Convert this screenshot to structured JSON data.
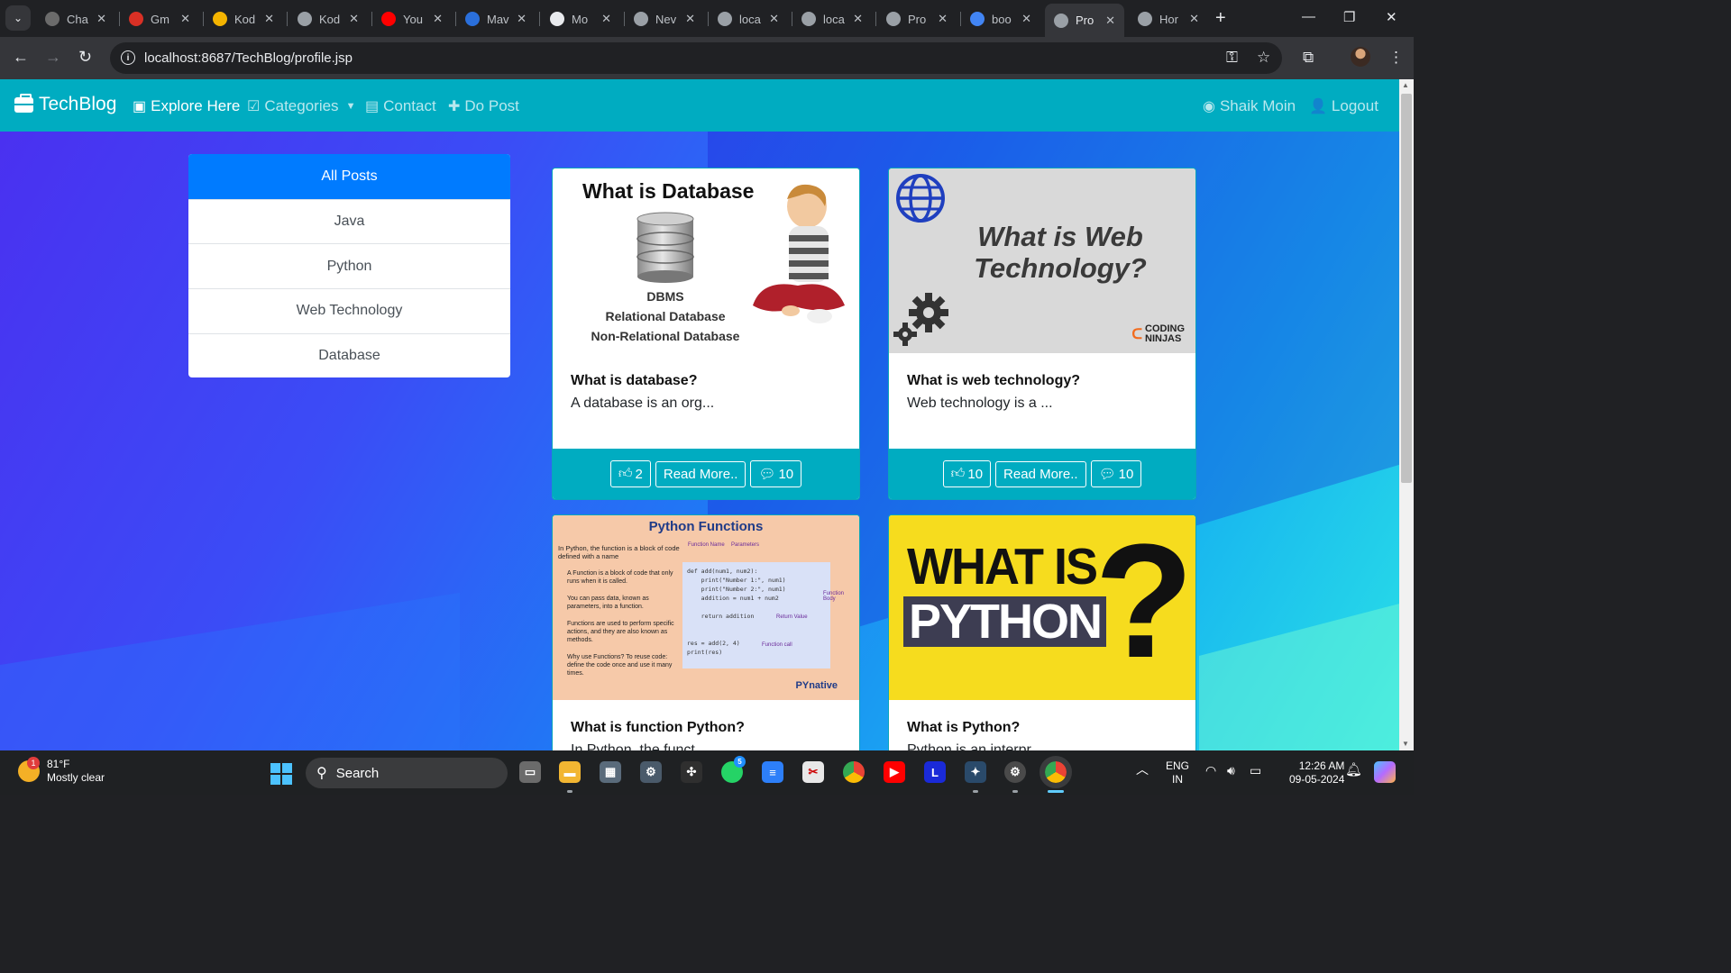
{
  "browser": {
    "tabs": [
      {
        "label": "Cha",
        "icon": "chatgpt-icon",
        "color": "#6b6b6b"
      },
      {
        "label": "Gm",
        "icon": "gmail-icon",
        "color": "#d93025"
      },
      {
        "label": "Kod",
        "icon": "kodnest-icon",
        "color": "#f4b400"
      },
      {
        "label": "Kod",
        "icon": "globe-icon",
        "color": "#9aa0a6"
      },
      {
        "label": "You",
        "icon": "youtube-icon",
        "color": "#ff0000"
      },
      {
        "label": "Mav",
        "icon": "maven-icon",
        "color": "#2a6fdb"
      },
      {
        "label": "Mo",
        "icon": "github-icon",
        "color": "#e8eaed"
      },
      {
        "label": "Nev",
        "icon": "globe-icon",
        "color": "#9aa0a6"
      },
      {
        "label": "loca",
        "icon": "globe-icon",
        "color": "#9aa0a6"
      },
      {
        "label": "loca",
        "icon": "globe-icon",
        "color": "#9aa0a6"
      },
      {
        "label": "Pro",
        "icon": "globe-icon",
        "color": "#9aa0a6"
      },
      {
        "label": "boo",
        "icon": "google-icon",
        "color": "#4285f4"
      },
      {
        "label": "Pro",
        "icon": "globe-icon",
        "color": "#9aa0a6",
        "active": true
      },
      {
        "label": "Hor",
        "icon": "globe-icon",
        "color": "#9aa0a6"
      }
    ],
    "url": "localhost:8687/TechBlog/profile.jsp"
  },
  "navbar": {
    "brand": "TechBlog",
    "explore": "Explore Here",
    "categories": "Categories",
    "contact": "Contact",
    "do_post": "Do Post",
    "user": "Shaik Moin",
    "logout": "Logout",
    "bg_color": "#00acc1"
  },
  "categories": {
    "items": [
      "All Posts",
      "Java",
      "Python",
      "Web Technology",
      "Database"
    ],
    "active_color": "#007bff"
  },
  "posts": [
    {
      "title": "What is database?",
      "excerpt": "A database is an org...",
      "likes": "2",
      "read_more": "Read More..",
      "comments": "10",
      "thumb": {
        "heading": "What is Database",
        "lines": [
          "DBMS",
          "Relational Database",
          "Non-Relational Database"
        ]
      }
    },
    {
      "title": "What is web technology?",
      "excerpt": "Web technology is a ...",
      "likes": "10",
      "read_more": "Read More..",
      "comments": "10",
      "thumb": {
        "heading": "What is Web Technology?",
        "brand_top": "CODING",
        "brand_bottom": "NINJAS"
      }
    },
    {
      "title": "What is function Python?",
      "excerpt": "In Python, the funct...",
      "thumb": {
        "heading": "Python Functions",
        "intro": "In Python, the function is a block of code defined with a name",
        "bullets": [
          "A Function is a block of code that only runs when it is called.",
          "You can pass data, known as parameters, into a function.",
          "Functions are used to perform specific actions, and they are also known as methods.",
          "Why use Functions? To reuse code: define the code once and use it many times."
        ],
        "label_name": "Function Name",
        "label_params": "Parameters",
        "label_body": "Function Body",
        "label_return": "Return Value",
        "label_call": "Function call",
        "code": "def add(num1, num2):\n    print(\"Number 1:\", num1)\n    print(\"Number 2:\", num1)\n    addition = num1 + num2\n\n    return addition\n\n\nres = add(2, 4)\nprint(res)",
        "brand": "PYnative"
      }
    },
    {
      "title": "What is Python?",
      "excerpt": "Python is an interpr...",
      "thumb": {
        "line1": "WHAT IS",
        "line2": "PYTHON",
        "mark": "?"
      }
    }
  ],
  "taskbar": {
    "temp": "81°F",
    "weather": "Mostly clear",
    "weather_badge": "1",
    "search": "Search",
    "whatsapp_badge": "5",
    "lang1": "ENG",
    "lang2": "IN",
    "time": "12:26 AM",
    "date": "09-05-2024"
  }
}
